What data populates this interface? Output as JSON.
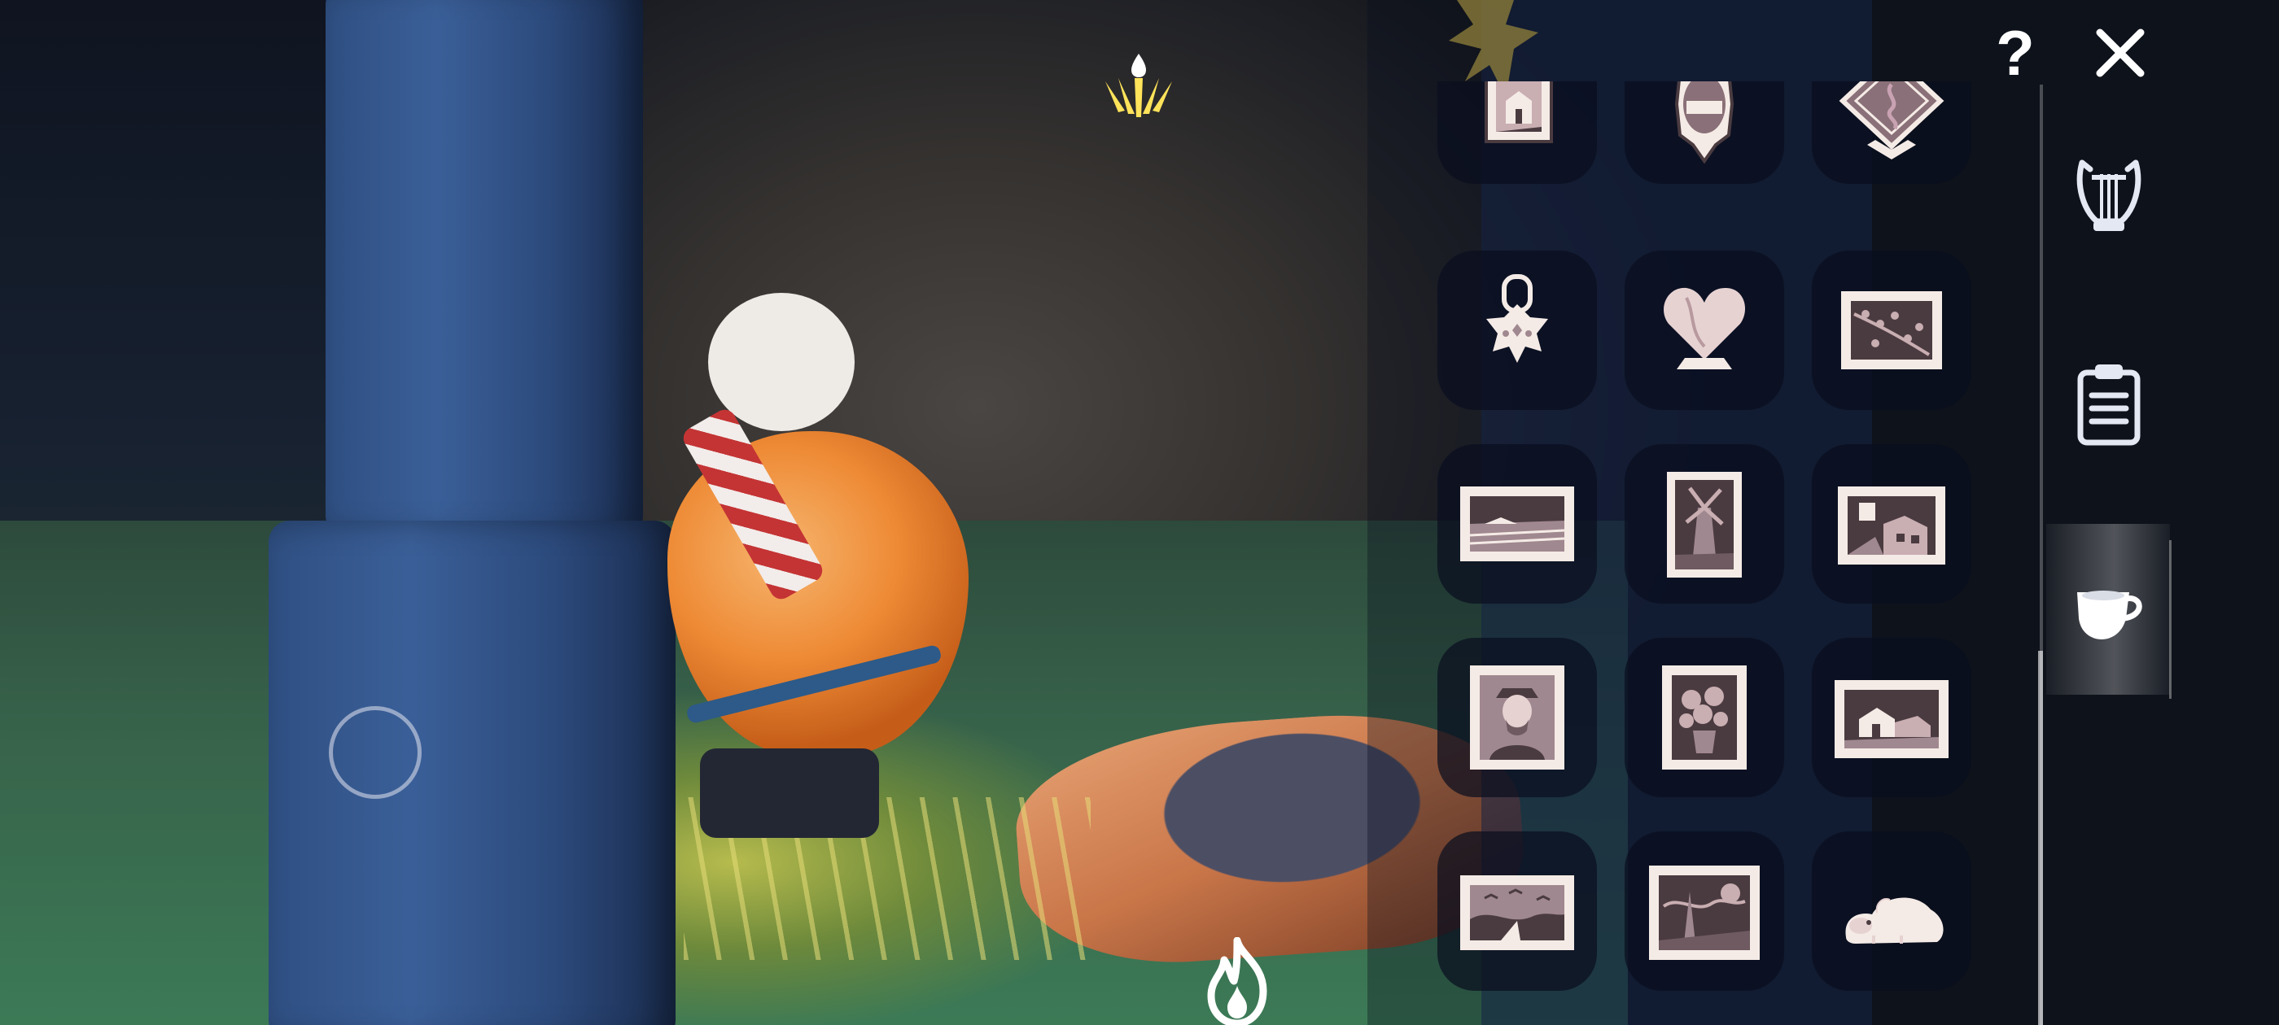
{
  "hud": {
    "candle_icon": "candle-wing-icon",
    "joystick_icon": "joystick-ring",
    "flame_icon": "flame-icon",
    "help_label": "?",
    "close_label": "✕"
  },
  "colors": {
    "icon_tint": "#f5ebe6",
    "icon_dark": "#4a3b40",
    "cell_background": "#0a0e1e",
    "candle_yellow": "#ffe35a"
  },
  "items": [
    {
      "name": "framed-house-painting-icon"
    },
    {
      "name": "oval-mirror-icon"
    },
    {
      "name": "diamond-sigil-sign-icon"
    },
    {
      "name": "hanging-star-lantern-icon"
    },
    {
      "name": "heart-stone-statue-icon"
    },
    {
      "name": "blossom-branch-painting-icon"
    },
    {
      "name": "landscape-field-painting-icon"
    },
    {
      "name": "windmill-painting-icon"
    },
    {
      "name": "village-street-painting-icon"
    },
    {
      "name": "portrait-painting-icon"
    },
    {
      "name": "sunflowers-painting-icon"
    },
    {
      "name": "cottage-painting-icon"
    },
    {
      "name": "wheatfield-crows-painting-icon"
    },
    {
      "name": "starry-night-painting-icon"
    },
    {
      "name": "sleeping-creature-plush-icon"
    }
  ],
  "tabs": [
    {
      "name": "lyre-icon",
      "selected": false
    },
    {
      "name": "clipboard-icon",
      "selected": false
    },
    {
      "name": "teacup-icon",
      "selected": true
    }
  ]
}
